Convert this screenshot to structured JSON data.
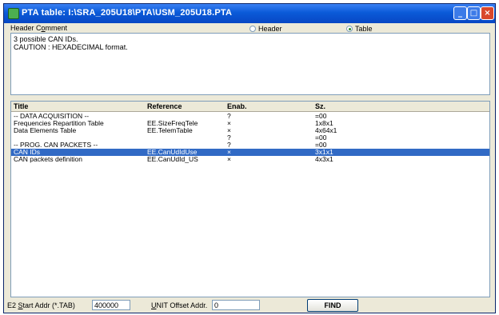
{
  "window": {
    "title": "PTA table: I:\\SRA_205U18\\PTA\\USM_205U18.PTA",
    "buttons": {
      "minimize": "_",
      "maximize": "□",
      "close": "×"
    }
  },
  "header": {
    "label_prefix": "Header C",
    "label_mnemonic": "o",
    "label_suffix": "mment",
    "radio_header": "Header",
    "radio_table": "Table",
    "selected": "Table"
  },
  "comment": {
    "lines": [
      "3 possible CAN IDs.",
      "CAUTION : HEXADECIMAL format."
    ]
  },
  "table": {
    "columns": [
      "Title",
      "Reference",
      "Enab.",
      "Sz."
    ],
    "rows": [
      {
        "title": "-- DATA ACQUISITION --",
        "reference": "",
        "enab": "?",
        "sz": "=00",
        "selected": false
      },
      {
        "title": "Frequencies Repartition Table",
        "reference": "EE.SizeFreqTele",
        "enab": "×",
        "sz": "1x8x1",
        "selected": false
      },
      {
        "title": "Data Elements Table",
        "reference": "EE.TelemTable",
        "enab": "×",
        "sz": "4x64x1",
        "selected": false
      },
      {
        "title": "",
        "reference": "",
        "enab": "?",
        "sz": "=00",
        "selected": false
      },
      {
        "title": "-- PROG. CAN PACKETS --",
        "reference": "",
        "enab": "?",
        "sz": "=00",
        "selected": false
      },
      {
        "title": "CAN IDs",
        "reference": "EE.CanUdIdUse",
        "enab": "×",
        "sz": "3x1x1",
        "selected": true
      },
      {
        "title": "CAN packets definition",
        "reference": "EE.CanUdId_US",
        "enab": "×",
        "sz": "4x3x1",
        "selected": false
      }
    ]
  },
  "bottom": {
    "e2_label_prefix": "E2 ",
    "e2_label_mnemonic": "S",
    "e2_label_suffix": "tart Addr (*.TAB)",
    "e2_value": "400000",
    "unit_label_prefix": "U",
    "unit_label_suffix": "NIT Offset Addr.",
    "unit_value": "0",
    "find_label": "FIND"
  },
  "colors": {
    "title_bar": "#0a5ad8",
    "selection": "#316ac5",
    "window_bg": "#ece9d8"
  },
  "icons": [
    "app-icon",
    "minimize-icon",
    "maximize-icon",
    "close-icon"
  ]
}
